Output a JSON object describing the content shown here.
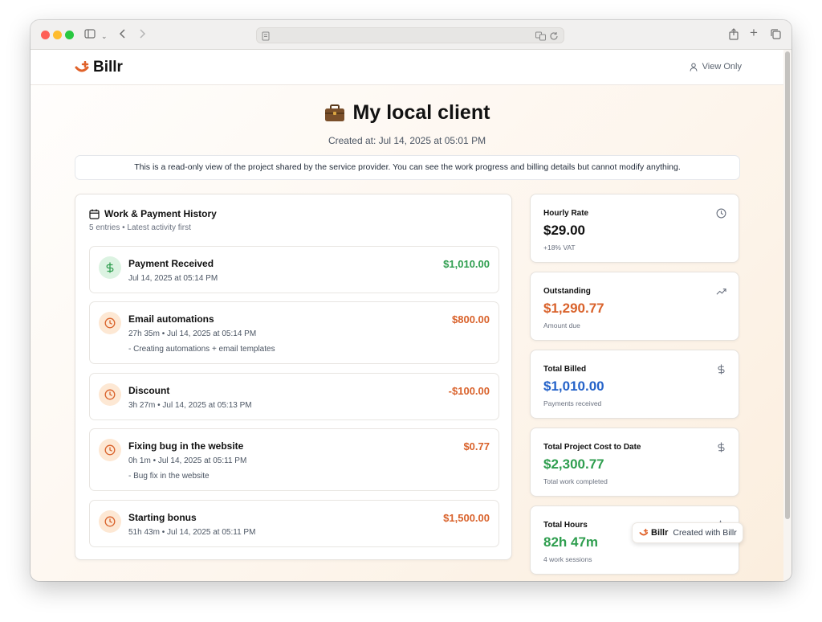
{
  "app": {
    "brand": "Billr",
    "view_only": "View Only",
    "accent_color": "#e0622a"
  },
  "project": {
    "title_icon": "briefcase-icon",
    "title": "My local client",
    "created_at": "Created at: Jul 14, 2025 at 05:01 PM",
    "notice": "This is a read-only view of the project shared by the service provider. You can see the work progress and billing details but cannot modify anything."
  },
  "history": {
    "title": "Work & Payment History",
    "subtitle": "5 entries • Latest activity first",
    "entries": [
      {
        "icon": "dollar-icon",
        "title": "Payment Received",
        "meta": "Jul 14, 2025 at 05:14 PM",
        "note": "",
        "amount": "$1,010.00",
        "amount_color": "#2f9e4f"
      },
      {
        "icon": "clock-icon",
        "title": "Email automations",
        "meta": "27h 35m • Jul 14, 2025 at 05:14 PM",
        "note": "- Creating automations + email templates",
        "amount": "$800.00",
        "amount_color": "#d9622b"
      },
      {
        "icon": "clock-icon",
        "title": "Discount",
        "meta": "3h 27m • Jul 14, 2025 at 05:13 PM",
        "note": "",
        "amount": "-$100.00",
        "amount_color": "#d9622b"
      },
      {
        "icon": "clock-icon",
        "title": "Fixing bug in the website",
        "meta": "0h 1m • Jul 14, 2025 at 05:11 PM",
        "note": "- Bug fix in the website",
        "amount": "$0.77",
        "amount_color": "#d9622b"
      },
      {
        "icon": "clock-icon",
        "title": "Starting bonus",
        "meta": "51h 43m • Jul 14, 2025 at 05:11 PM",
        "note": "",
        "amount": "$1,500.00",
        "amount_color": "#d9622b"
      }
    ]
  },
  "stats": [
    {
      "label": "Hourly Rate",
      "value": "$29.00",
      "sub": "+18% VAT",
      "icon": "clock-icon",
      "color": "#111111"
    },
    {
      "label": "Outstanding",
      "value": "$1,290.77",
      "sub": "Amount due",
      "icon": "trending-up-icon",
      "color": "#d9622b"
    },
    {
      "label": "Total Billed",
      "value": "$1,010.00",
      "sub": "Payments received",
      "icon": "dollar-icon",
      "color": "#2563c9"
    },
    {
      "label": "Total Project Cost to Date",
      "value": "$2,300.77",
      "sub": "Total work completed",
      "icon": "dollar-icon",
      "color": "#2f9e4f"
    },
    {
      "label": "Total Hours",
      "value": "82h 47m",
      "sub": "4 work sessions",
      "icon": "activity-icon",
      "color": "#2f9e4f"
    }
  ],
  "badge": {
    "brand": "Billr",
    "text": "Created with Billr"
  }
}
